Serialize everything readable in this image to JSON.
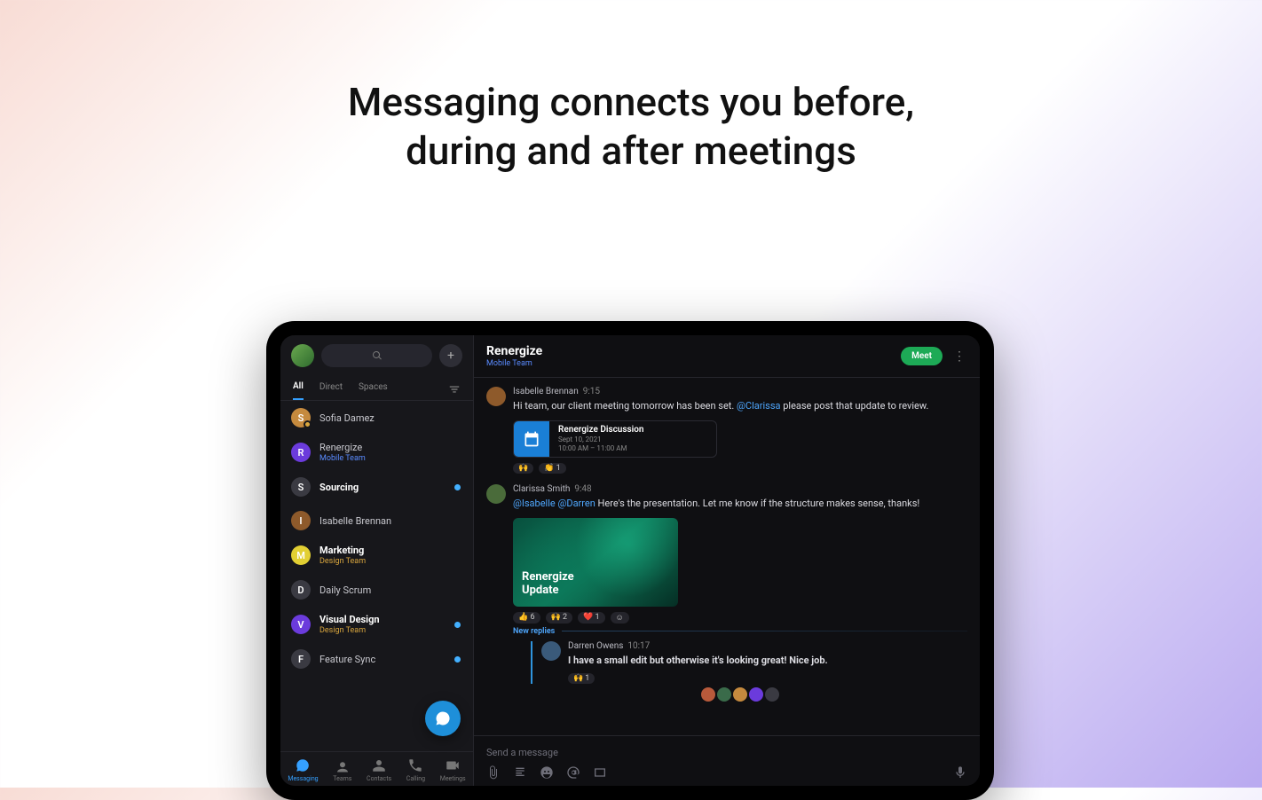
{
  "headline_l1": "Messaging connects you before,",
  "headline_l2": "during and after meetings",
  "sidebar": {
    "tabs": {
      "all": "All",
      "direct": "Direct",
      "spaces": "Spaces"
    },
    "items": [
      {
        "name": "Sofia Damez",
        "initial": "S",
        "color": "#c58a3e",
        "presence": "away"
      },
      {
        "name": "Renergize",
        "sub": "Mobile Team",
        "initial": "R",
        "color": "#6b3bdc",
        "subclass": "team1"
      },
      {
        "name": "Sourcing",
        "initial": "S",
        "color": "#3a3a42",
        "bold": true,
        "unread": true
      },
      {
        "name": "Isabelle Brennan",
        "initial": "I",
        "color": "#8e5a2b"
      },
      {
        "name": "Marketing",
        "sub": "Design Team",
        "initial": "M",
        "color": "#e2cf33",
        "subclass": "team2",
        "bold": true
      },
      {
        "name": "Daily Scrum",
        "initial": "D",
        "color": "#3a3a42"
      },
      {
        "name": "Visual Design",
        "sub": "Design Team",
        "initial": "V",
        "color": "#6b3bdc",
        "subclass": "team2",
        "bold": true,
        "unread": true
      },
      {
        "name": "Feature Sync",
        "initial": "F",
        "color": "#3a3a42",
        "unread": true
      }
    ]
  },
  "bottomnav": [
    {
      "label": "Messaging"
    },
    {
      "label": "Teams"
    },
    {
      "label": "Contacts"
    },
    {
      "label": "Calling"
    },
    {
      "label": "Meetings"
    }
  ],
  "header": {
    "title": "Renergize",
    "subtitle": "Mobile Team",
    "meet": "Meet"
  },
  "messages": {
    "m1": {
      "author": "Isabelle Brennan",
      "time": "9:15",
      "pre": "Hi team, our client meeting tomorrow has been set. ",
      "mention": "@Clarissa",
      "post": " please post that update to review.",
      "event": {
        "title": "Renergize Discussion",
        "date": "Sept 10, 2021",
        "time": "10:00 AM – 11:00 AM"
      },
      "reacts": [
        {
          "e": "🙌",
          "c": ""
        },
        {
          "e": "👏",
          "c": "1"
        }
      ]
    },
    "m2": {
      "author": "Clarissa Smith",
      "time": "9:48",
      "m1": "@Isabelle",
      "m2": "@Darren",
      "post": " Here's the presentation. Let me know if the structure makes sense, thanks!",
      "thumb_l1": "Renergize",
      "thumb_l2": "Update",
      "reacts": [
        {
          "e": "👍",
          "c": "6"
        },
        {
          "e": "🙌",
          "c": "2"
        },
        {
          "e": "❤️",
          "c": "1"
        },
        {
          "e": "☺",
          "c": ""
        }
      ],
      "replies_label": "New replies"
    },
    "reply": {
      "author": "Darren Owens",
      "time": "10:17",
      "text": "I have a small edit but otherwise it's looking great! Nice job.",
      "react": {
        "e": "🙌",
        "c": "1"
      }
    }
  },
  "composer": {
    "placeholder": "Send a message"
  },
  "avatars_bottom": [
    "#b85a3b",
    "#3a6b4a",
    "#c58a3e",
    "#6b3bdc",
    "#3a3a42"
  ]
}
